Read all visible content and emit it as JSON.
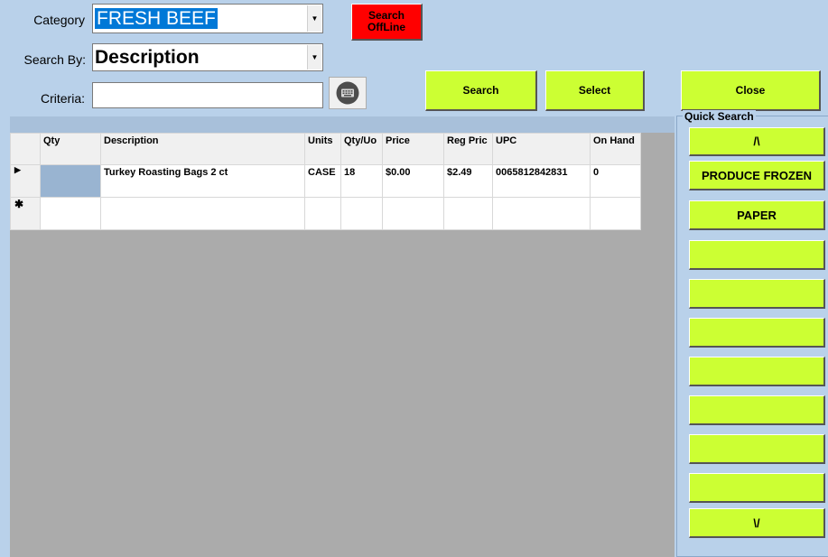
{
  "form": {
    "category_label": "Category",
    "category_value": "FRESH BEEF",
    "searchby_label": "Search By:",
    "searchby_value": "Description",
    "criteria_label": "Criteria:",
    "criteria_value": ""
  },
  "buttons": {
    "search_offline": "Search\nOffLine",
    "search": "Search",
    "select": "Select",
    "close": "Close"
  },
  "grid": {
    "columns": [
      "Qty",
      "Description",
      "Units",
      "Qty/Uo",
      "Price",
      "Reg Pric",
      "UPC",
      "On Hand"
    ],
    "rows": [
      {
        "row_marker": "▶",
        "qty": "",
        "description": "Turkey Roasting Bags 2 ct",
        "units": "CASE",
        "qty_uom": "18",
        "price": "$0.00",
        "reg_price": "$2.49",
        "upc": "0065812842831",
        "on_hand": "0"
      }
    ],
    "new_row_marker": "✱"
  },
  "quick_search": {
    "title": "Quick Search",
    "up_label": "/\\",
    "down_label": "\\/",
    "buttons": [
      "PRODUCE FROZEN",
      "PAPER",
      "",
      "",
      "",
      "",
      "",
      "",
      ""
    ]
  },
  "colors": {
    "accent_green": "#ccff33",
    "offline_red": "#ff0000",
    "background": "#b9d1ea",
    "selection": "#0078d7"
  }
}
